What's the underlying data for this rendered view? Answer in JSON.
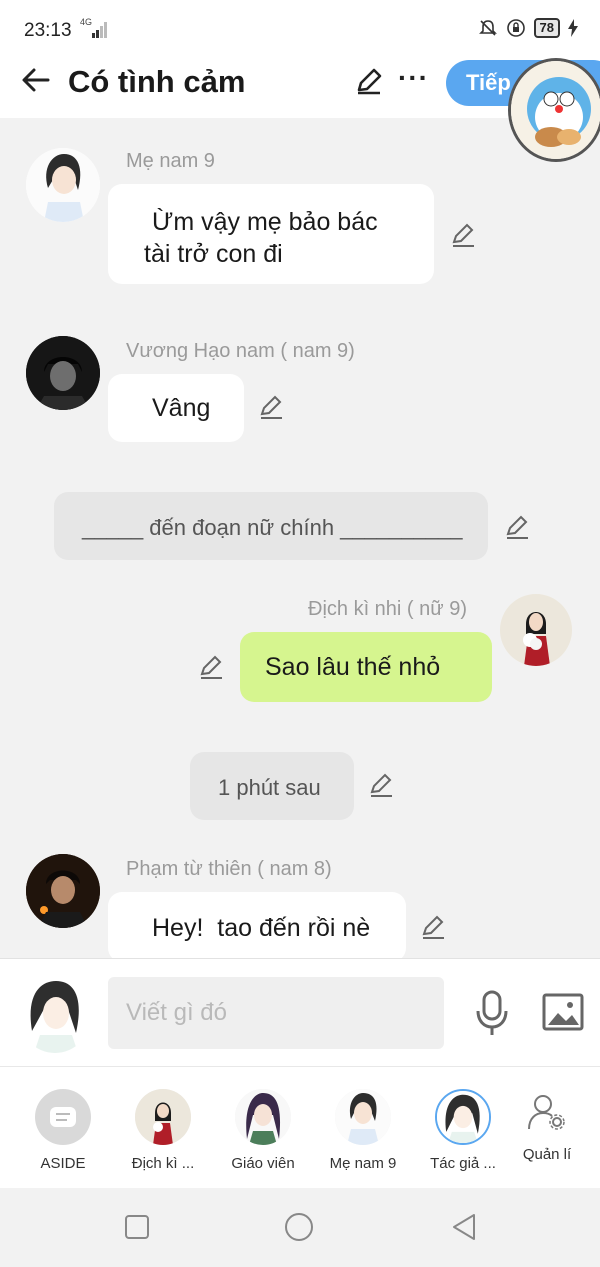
{
  "status_bar": {
    "time": "23:13",
    "network": "4G",
    "battery": "78"
  },
  "header": {
    "back_icon": "arrow-left-icon",
    "title": "Có tình cảm",
    "next_label": "Tiếp"
  },
  "messages": [
    {
      "sender": "Mẹ nam 9",
      "text_lines": [
        "Ừm vậy mẹ bảo bác",
        "tài trở con đi"
      ],
      "side": "left"
    },
    {
      "sender": "Vương Hạo nam ( nam 9)",
      "text": "Vâng",
      "side": "left"
    },
    {
      "narration": "_____ đến đoạn nữ chính __________"
    },
    {
      "sender": "Địch kì nhi ( nữ 9)",
      "text": "Sao lâu thế nhỏ",
      "side": "right"
    },
    {
      "narration": "1 phút sau"
    },
    {
      "sender": "Phạm từ thiên ( nam 8)",
      "text": "Hey!  tao đến rồi nè",
      "side": "left"
    }
  ],
  "composer": {
    "placeholder": "Viết gì đó",
    "mic_icon": "microphone-icon",
    "image_icon": "image-icon"
  },
  "characters": [
    {
      "label": "ASIDE"
    },
    {
      "label": "Địch kì ..."
    },
    {
      "label": "Giáo viên"
    },
    {
      "label": "Mẹ nam 9"
    },
    {
      "label": "Tác giả ..."
    },
    {
      "label": "Quản lí"
    }
  ],
  "colors": {
    "accent_blue": "#5aa7f0",
    "green_bubble": "#d6f58f",
    "background": "#f2f2f2"
  }
}
